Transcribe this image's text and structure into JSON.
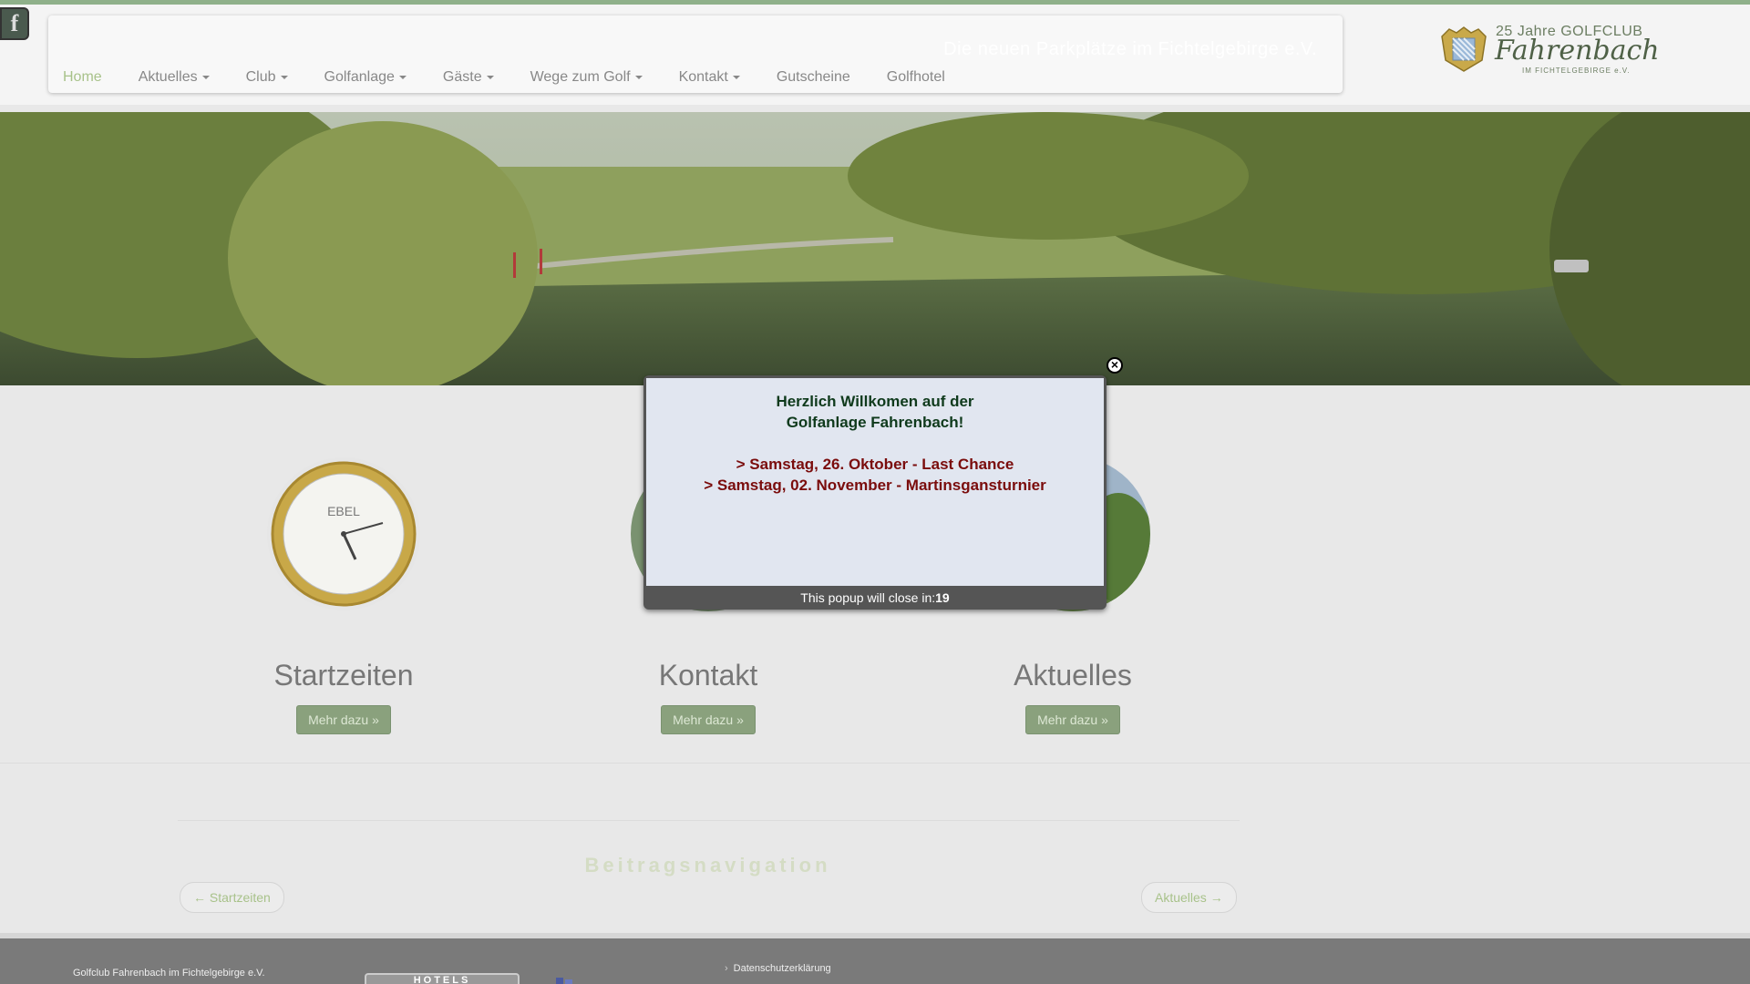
{
  "header": {
    "facebook_letter": "f",
    "tagline": "Die neuen Parkplätze im Fichtelgebirge e.V.",
    "nav": [
      {
        "label": "Home"
      },
      {
        "label": "Aktuelles"
      },
      {
        "label": "Club"
      },
      {
        "label": "Golfanlage"
      },
      {
        "label": "Gäste"
      },
      {
        "label": "Wege zum Golf"
      },
      {
        "label": "Kontakt"
      },
      {
        "label": "Gutscheine"
      },
      {
        "label": "Golfhotel"
      }
    ],
    "logo": {
      "line1": "25 Jahre GOLFCLUB",
      "line2": "Fahrenbach",
      "line3": "IM FICHTELGEBIRGE e.V."
    }
  },
  "features": [
    {
      "title": "Startzeiten",
      "button": "Mehr dazu »"
    },
    {
      "title": "Kontakt",
      "button": "Mehr dazu »"
    },
    {
      "title": "Aktuelles",
      "button": "Mehr dazu »"
    }
  ],
  "clock_brand": "EBEL",
  "post_nav": {
    "heading": "Beitragsnavigation",
    "prev": "← Startzeiten",
    "next": "Aktuelles →"
  },
  "footer": {
    "club_name": "Golfclub Fahrenbach im Fichtelgebirge e.V.",
    "privacy_link": "Datenschutzerklärung",
    "hotel_badge": "HOTELS"
  },
  "popup": {
    "welcome_line1": "Herzlich Willkomen auf der",
    "welcome_line2": "Golfanlage Fahrenbach!",
    "event1": "> Samstag, 26. Oktober - Last Chance",
    "event2": "> Samstag, 02. November - Martinsgansturnier",
    "close_prefix": "This popup will close in:",
    "countdown": "19"
  },
  "colors": {
    "accent_green": "#a8c28a",
    "button_green": "#8aa17d",
    "popup_title": "#0f3a1c",
    "popup_event": "#7a0c0c"
  }
}
